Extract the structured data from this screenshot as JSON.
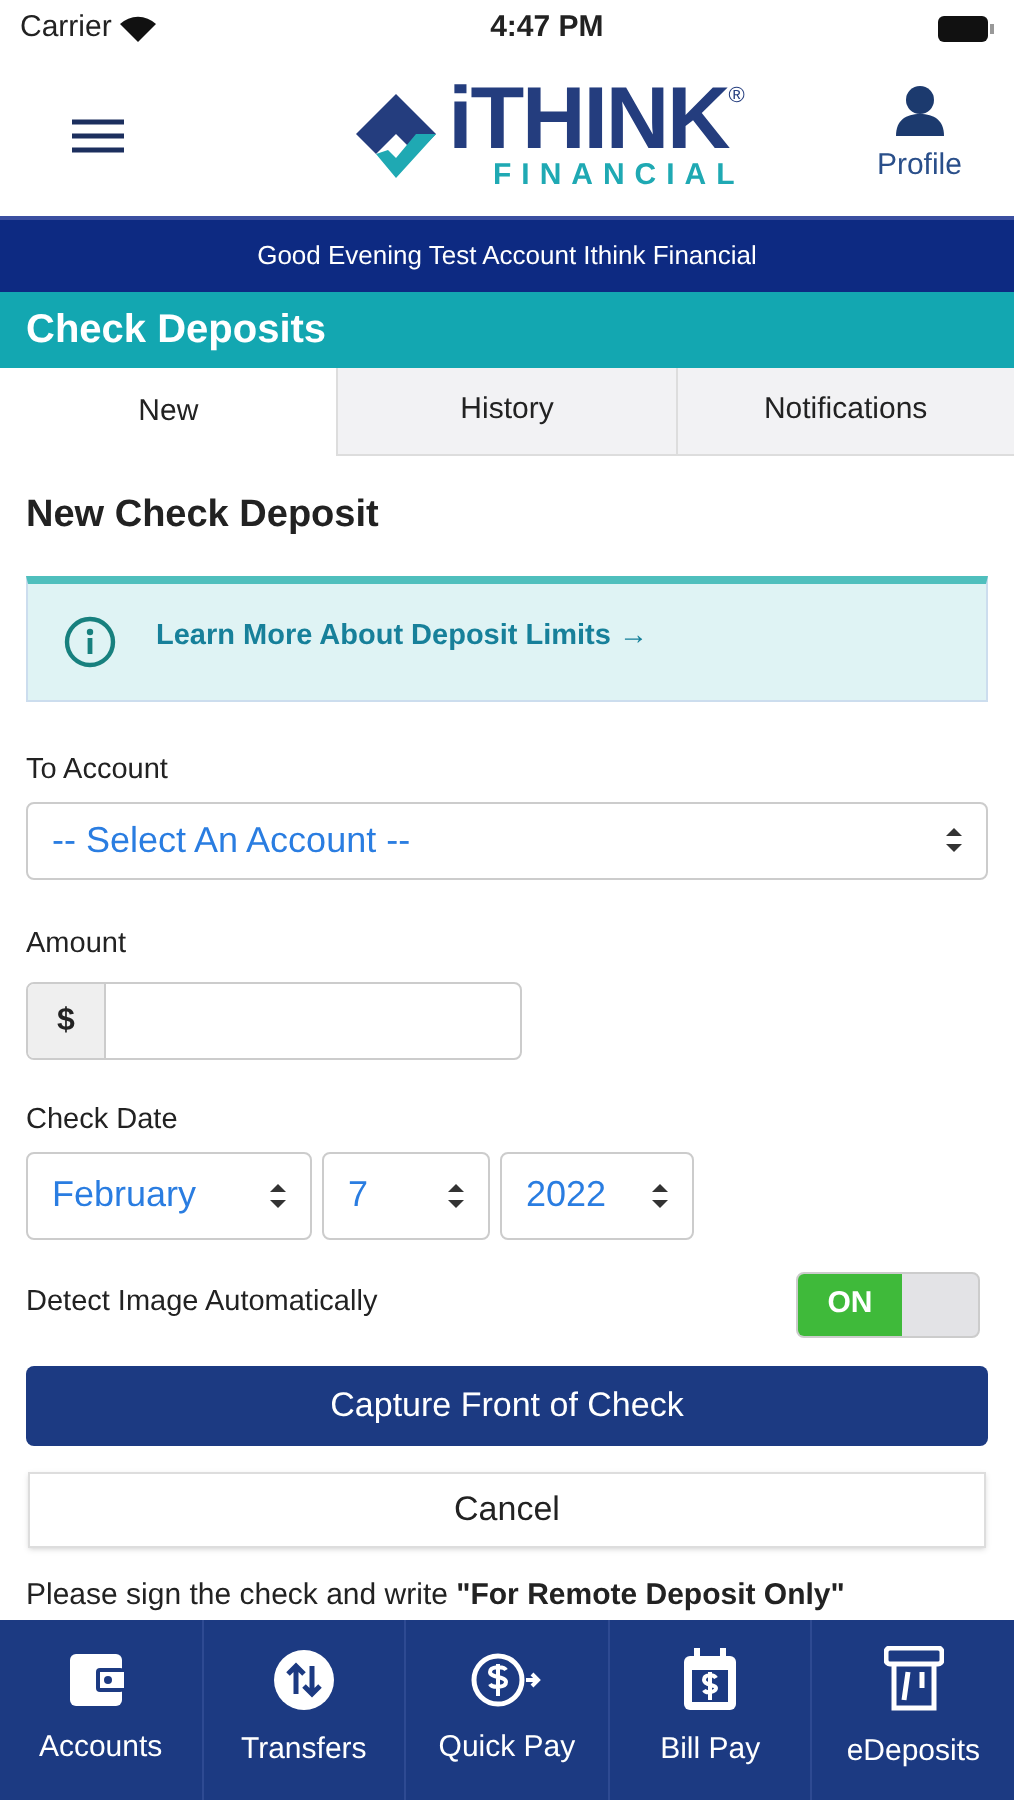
{
  "status_bar": {
    "carrier": "Carrier",
    "time": "4:47 PM"
  },
  "header": {
    "logo_word": "iTHINK",
    "logo_mark": "®",
    "logo_sub": "FINANCIAL",
    "profile": "Profile"
  },
  "greeting": "Good Evening Test Account Ithink Financial",
  "page_title": "Check Deposits",
  "tabs": [
    {
      "label": "New",
      "selected": true
    },
    {
      "label": "History",
      "selected": false
    },
    {
      "label": "Notifications",
      "selected": false
    }
  ],
  "form": {
    "heading": "New Check Deposit",
    "info_link": "Learn More About Deposit Limits →",
    "account_label": "To Account",
    "account_value": "-- Select An Account --",
    "amount_label": "Amount",
    "currency": "$",
    "date_label": "Check Date",
    "month": "February",
    "day": "7",
    "year": "2022",
    "detect_label": "Detect Image Automatically",
    "detect_switch": {
      "on": true,
      "on_text": "ON"
    },
    "capture_button": "Capture Front of Check",
    "cancel_button": "Cancel",
    "note": "Please sign the check and write **\"For Remote Deposit Only\"**"
  },
  "bottom_nav": [
    {
      "label": "Accounts",
      "kind": "wallet"
    },
    {
      "label": "Transfers",
      "kind": "transfer"
    },
    {
      "label": "Quick Pay",
      "kind": "quickpay"
    },
    {
      "label": "Bill Pay",
      "kind": "billpay"
    },
    {
      "label": "eDeposits",
      "kind": "deposit"
    }
  ]
}
